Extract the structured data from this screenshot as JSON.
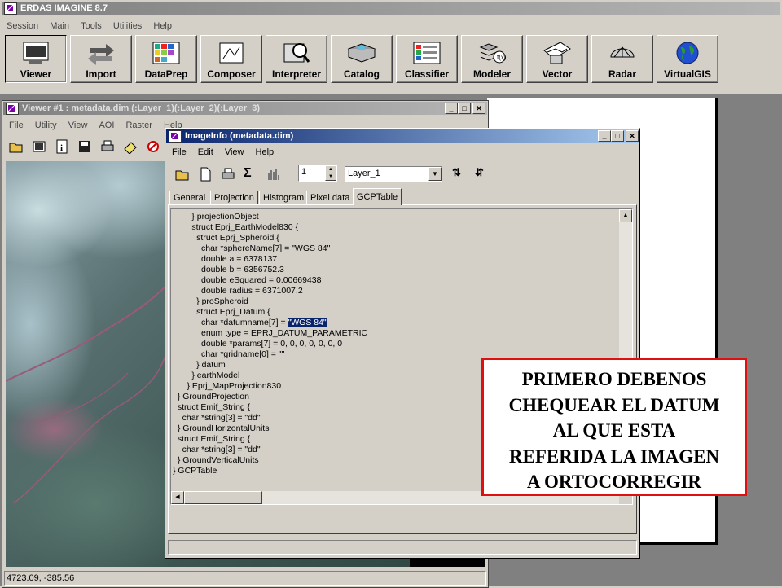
{
  "app": {
    "title": "ERDAS IMAGINE 8.7",
    "menu": [
      "Session",
      "Main",
      "Tools",
      "Utilities",
      "Help"
    ],
    "toolbar": [
      "Viewer",
      "Import",
      "DataPrep",
      "Composer",
      "Interpreter",
      "Catalog",
      "Classifier",
      "Modeler",
      "Vector",
      "Radar",
      "VirtualGIS"
    ]
  },
  "viewer": {
    "title": "Viewer #1 : metadata.dim (:Layer_1)(:Layer_2)(:Layer_3)",
    "menu": [
      "File",
      "Utility",
      "View",
      "AOI",
      "Raster",
      "Help"
    ],
    "status": "4723.09, -385.56"
  },
  "imageinfo": {
    "title": "ImageInfo (metadata.dim)",
    "menu": [
      "File",
      "Edit",
      "View",
      "Help"
    ],
    "band_value": "1",
    "layer_value": "Layer_1",
    "tabs": [
      "General",
      "Projection",
      "Histogram",
      "Pixel data",
      "GCPTable"
    ],
    "active_tab": "GCPTable",
    "code_before": "        } projectionObject\n        struct Eprj_EarthModel830 {\n          struct Eprj_Spheroid {\n            char *sphereName[7] = \"WGS 84\"\n            double a = 6378137\n            double b = 6356752.3\n            double eSquared = 0.00669438\n            double radius = 6371007.2\n          } proSpheroid\n          struct Eprj_Datum {\n            char *datumname[7] = ",
    "code_highlight": "\"WGS 84\"",
    "code_after": "\n            enum type = EPRJ_DATUM_PARAMETRIC\n            double *params[7] = 0, 0, 0, 0, 0, 0, 0\n            char *gridname[0] = \"\"\n          } datum\n        } earthModel\n      } Eprj_MapProjection830\n  } GroundProjection\n  struct Emif_String {\n    char *string[3] = \"dd\"\n  } GroundHorizontalUnits\n  struct Emif_String {\n    char *string[3] = \"dd\"\n  } GroundVerticalUnits\n} GCPTable"
  },
  "callout": {
    "lines": [
      "PRIMERO DEBENOS",
      "CHEQUEAR EL DATUM",
      "AL QUE ESTA",
      "REFERIDA LA IMAGEN",
      "A ORTOCORREGIR"
    ],
    "border_color": "#e01010"
  }
}
